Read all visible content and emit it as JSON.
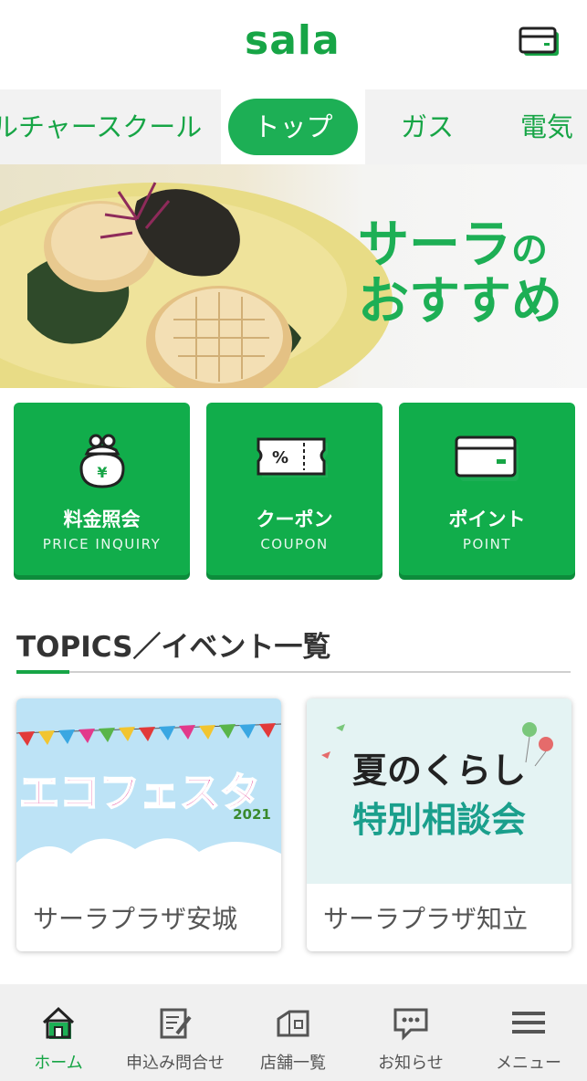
{
  "header": {
    "logo": "sala",
    "card_icon": "card-icon"
  },
  "tabs": {
    "items": [
      {
        "label": "カルチャースクール"
      },
      {
        "label": "トップ",
        "active": true
      },
      {
        "label": "ガス"
      },
      {
        "label": "電気"
      }
    ]
  },
  "hero": {
    "line1_main": "サーラ",
    "line1_suffix": "の",
    "line2": "おすすめ"
  },
  "quick_actions": [
    {
      "label": "料金照会",
      "sub": "PRICE INQUIRY",
      "icon": "purse-yen-icon"
    },
    {
      "label": "クーポン",
      "sub": "COUPON",
      "icon": "coupon-ticket-icon"
    },
    {
      "label": "ポイント",
      "sub": "POINT",
      "icon": "point-card-icon"
    }
  ],
  "topics": {
    "title": "TOPICS／イベント一覧",
    "cards": [
      {
        "banner_text": "エコフェスタ",
        "banner_year": "2021",
        "caption": "サーラプラザ安城"
      },
      {
        "banner_line1": "夏のくらし",
        "banner_line2": "特別相談会",
        "caption": "サーラプラザ知立"
      }
    ]
  },
  "bottom_nav": {
    "items": [
      {
        "label": "ホーム",
        "icon": "home-icon",
        "active": true
      },
      {
        "label": "申込み問合せ",
        "icon": "form-edit-icon"
      },
      {
        "label": "店舗一覧",
        "icon": "store-icon"
      },
      {
        "label": "お知らせ",
        "icon": "message-bubble-icon"
      },
      {
        "label": "メニュー",
        "icon": "hamburger-menu-icon"
      }
    ]
  },
  "colors": {
    "brand_green": "#17a546",
    "card_green": "#11ad4b",
    "banner_pink": "#e0318b",
    "banner_teal": "#1a9f8c"
  }
}
